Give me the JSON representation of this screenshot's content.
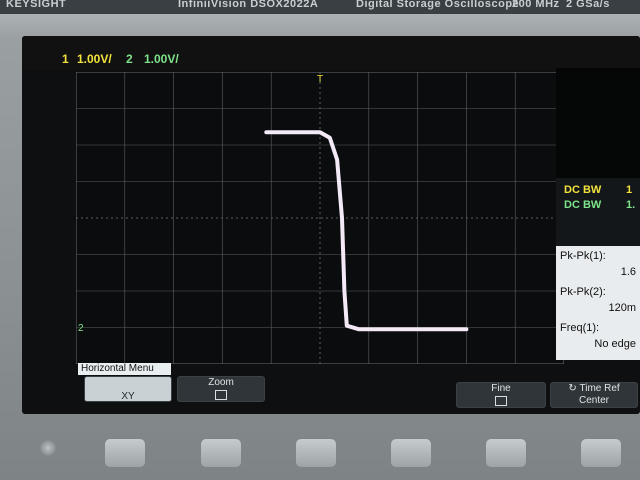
{
  "instrument": {
    "brand": "KEYSIGHT",
    "model": "InfiniiVision DSOX2022A",
    "description": "Digital Storage Oscilloscope",
    "bandwidth": "200 MHz",
    "sample_rate": "2 GSa/s"
  },
  "channels": [
    {
      "num": "1",
      "scale": "1.00V/",
      "color": "#f2e23d"
    },
    {
      "num": "2",
      "scale": "1.00V/",
      "color": "#7ee38a"
    }
  ],
  "trigger_marker": "T",
  "ground_marker": "2",
  "side_panel": {
    "dc_bw_rows": [
      {
        "label": "DC BW",
        "value": "1",
        "color": "#f2e23d"
      },
      {
        "label": "DC BW",
        "value": "1.",
        "color": "#7ee38a"
      }
    ],
    "measurements": [
      {
        "label": "Pk-Pk(1):",
        "value": "1.6"
      },
      {
        "label": "Pk-Pk(2):",
        "value": "120m"
      },
      {
        "label": "Freq(1):",
        "value": "No edge"
      }
    ]
  },
  "menu": {
    "title": "Horizontal Menu",
    "softkeys": [
      {
        "label": "XY",
        "active": true
      },
      {
        "label": "Zoom",
        "active": false
      },
      {
        "label": "Fine",
        "active": false
      },
      {
        "label": "Time Ref",
        "sublabel": "Center",
        "active": false
      }
    ]
  },
  "trace": {
    "color": "#f4e9f6",
    "x_units": "divisions",
    "y_units": "divisions",
    "points": [
      [
        -1.1,
        2.35
      ],
      [
        0,
        2.35
      ],
      [
        0.2,
        2.2
      ],
      [
        0.35,
        1.6
      ],
      [
        0.45,
        0
      ],
      [
        0.5,
        -2.0
      ],
      [
        0.55,
        -2.95
      ],
      [
        0.8,
        -3.05
      ],
      [
        3.0,
        -3.05
      ]
    ]
  },
  "colors": {
    "screen": "#0d0f10",
    "grid": "#5b6063",
    "softkey_active": "#c9d1d5"
  }
}
